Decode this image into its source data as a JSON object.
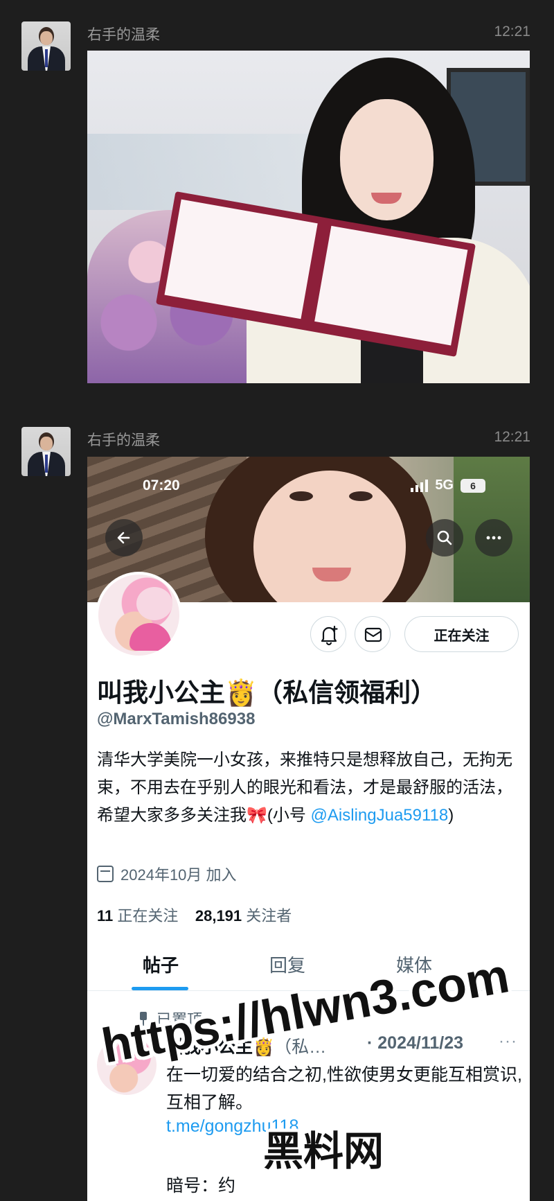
{
  "messages": [
    {
      "sender": "右手的温柔",
      "time": "12:21"
    },
    {
      "sender": "右手的温柔",
      "time": "12:21"
    }
  ],
  "screenshot": {
    "status": {
      "time": "07:20",
      "network": "5G",
      "battery": "6"
    },
    "icons": {
      "back": "back-arrow-icon",
      "search": "search-icon",
      "more": "more-icon",
      "notify": "bell-plus-icon",
      "message": "mail-icon",
      "calendar": "calendar-icon",
      "pin": "pin-icon"
    },
    "follow_button": "正在关注",
    "display_name": "叫我小公主👸（私信领福利）",
    "handle": "@MarxTamish86938",
    "bio_text": "清华大学美院一小女孩，来推特只是想释放自己，无拘无束，不用去在乎别人的眼光和看法，才是最舒服的活法，希望大家多多关注我🎀(小号 ",
    "bio_mention": "@AislingJua59118",
    "bio_end": ")",
    "joined": "2024年10月 加入",
    "following_count": "11",
    "following_label": "正在关注",
    "followers_count": "28,191",
    "followers_label": "关注者",
    "tabs": [
      "帖子",
      "回复",
      "媒体"
    ],
    "pinned_label": "已置顶",
    "post": {
      "name": "叫我小公主👸",
      "name_trunc": "（私…",
      "date": "· 2024/11/23",
      "more": "···",
      "text": "在一切爱的结合之初,性欲使男女更能互相赏识,互相了解。",
      "link": "t.me/gongzhu118",
      "text2": "暗号：约"
    }
  },
  "watermark": {
    "line1": "https://hlwn3.com",
    "line2": "黑料网"
  }
}
